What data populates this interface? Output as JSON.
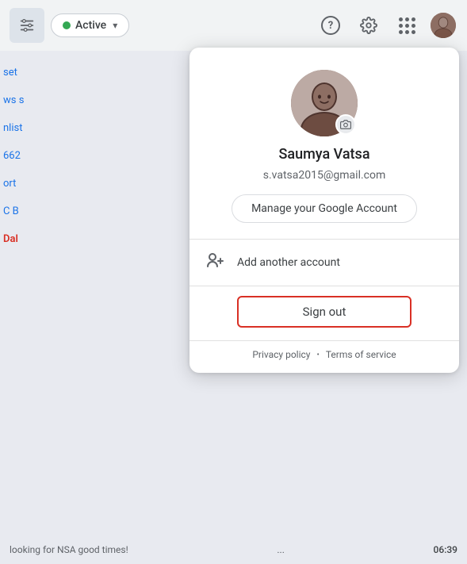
{
  "topbar": {
    "status_label": "Active",
    "filter_icon": "≡⇅",
    "question_mark": "?",
    "avatar_alt": "User avatar"
  },
  "dropdown": {
    "user_name": "Saumya Vatsa",
    "user_email": "s.vatsa2015@gmail.com",
    "manage_account_label": "Manage your Google Account",
    "add_account_label": "Add another account",
    "signout_label": "Sign out",
    "footer": {
      "privacy_label": "Privacy policy",
      "separator": "•",
      "terms_label": "Terms of service"
    }
  },
  "sidebar": {
    "items": [
      "set",
      "ws s",
      "nlist",
      "662",
      "ort",
      "C B",
      "Dal"
    ]
  },
  "bottom_bar": {
    "message_preview": "looking for NSA good times!",
    "dots": "...",
    "time": "06:39"
  }
}
